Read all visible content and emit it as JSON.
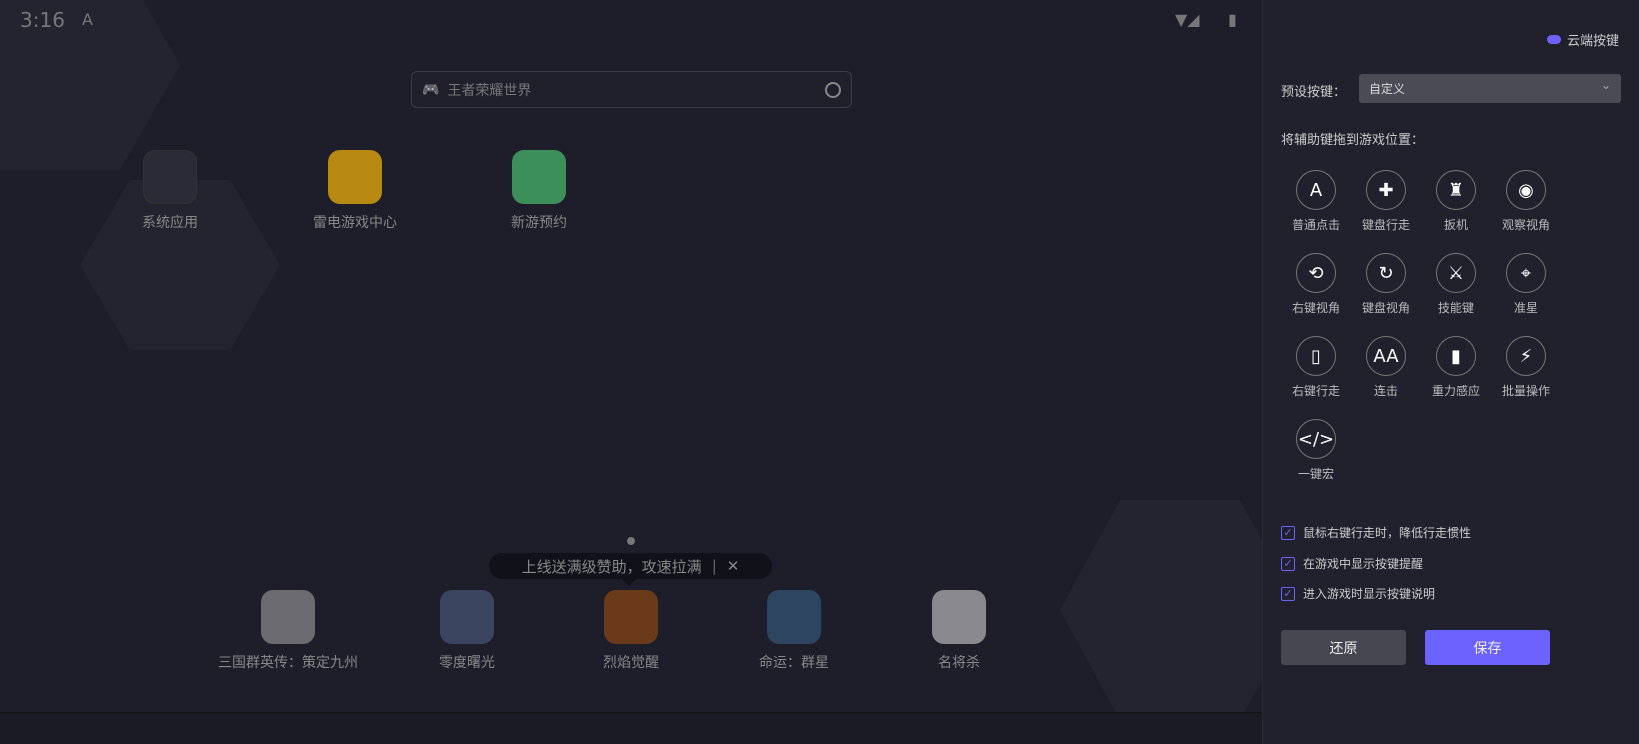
{
  "status": {
    "time": "3:16",
    "notif": "A"
  },
  "search": {
    "placeholder": "王者荣耀世界"
  },
  "apps": [
    {
      "label": "系统应用"
    },
    {
      "label": "雷电游戏中心"
    },
    {
      "label": "新游预约"
    }
  ],
  "tooltip": {
    "text": "上线送满级赞助，攻速拉满",
    "close": "✕"
  },
  "dock": [
    {
      "label": "三国群英传：策定九州"
    },
    {
      "label": "零度曙光"
    },
    {
      "label": "烈焰觉醒"
    },
    {
      "label": "命运：群星"
    },
    {
      "label": "名将杀"
    }
  ],
  "panel": {
    "cloud": "云端按键",
    "preset_label": "预设按键：",
    "preset_value": "自定义",
    "drag_label": "将辅助键拖到游戏位置：",
    "keys": [
      {
        "label": "普通点击",
        "glyph": "A"
      },
      {
        "label": "键盘行走",
        "glyph": "✚"
      },
      {
        "label": "扳机",
        "glyph": "♜"
      },
      {
        "label": "观察视角",
        "glyph": "◉"
      },
      {
        "label": "右键视角",
        "glyph": "⟲"
      },
      {
        "label": "键盘视角",
        "glyph": "↻"
      },
      {
        "label": "技能键",
        "glyph": "⚔"
      },
      {
        "label": "准星",
        "glyph": "⌖"
      },
      {
        "label": "右键行走",
        "glyph": "▯"
      },
      {
        "label": "连击",
        "glyph": "AA"
      },
      {
        "label": "重力感应",
        "glyph": "▮"
      },
      {
        "label": "批量操作",
        "glyph": "⚡"
      },
      {
        "label": "一键宏",
        "glyph": "</>"
      }
    ],
    "options": [
      {
        "label": "鼠标右键行走时，降低行走惯性",
        "checked": true
      },
      {
        "label": "在游戏中显示按键提醒",
        "checked": true
      },
      {
        "label": "进入游戏时显示按键说明",
        "checked": true
      }
    ],
    "reset": "还原",
    "save": "保存"
  },
  "colors": {
    "accent": "#6c63ff"
  }
}
